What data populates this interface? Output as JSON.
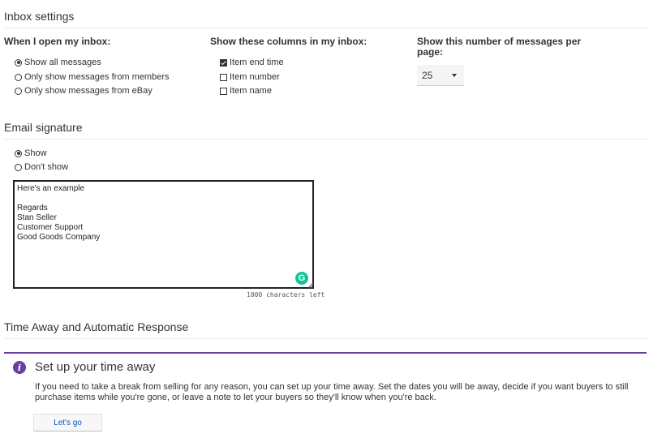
{
  "inbox": {
    "section_title": "Inbox settings",
    "open_inbox": {
      "heading": "When I open my inbox:",
      "options": [
        {
          "label": "Show all messages",
          "checked": true
        },
        {
          "label": "Only show messages from members",
          "checked": false
        },
        {
          "label": "Only show messages from eBay",
          "checked": false
        }
      ]
    },
    "columns": {
      "heading": "Show these columns in my inbox:",
      "options": [
        {
          "label": "Item end time",
          "checked": true
        },
        {
          "label": "Item number",
          "checked": false
        },
        {
          "label": "Item name",
          "checked": false
        }
      ]
    },
    "per_page": {
      "heading_line1": "Show this number of messages per",
      "heading_line2": "page:",
      "value": "25"
    }
  },
  "signature": {
    "section_title": "Email signature",
    "options": [
      {
        "label": "Show",
        "checked": true
      },
      {
        "label": "Don't show",
        "checked": false
      }
    ],
    "text": "Here's an example\n\nRegards\nStan Seller\nCustomer Support\nGood Goods Company",
    "counter": "1000 characters left",
    "grammarly_letter": "G"
  },
  "time_away": {
    "section_title": "Time Away and Automatic Response",
    "notice_title": "Set up your time away",
    "notice_body": "If you need to take a break from selling for any reason, you can set up your time away. Set the dates you will be away, decide if you want buyers to still purchase items while you're gone, or leave a note to let your buyers so they'll know when you're back.",
    "button_label": "Let's go",
    "info_glyph": "i"
  },
  "colors": {
    "accent_purple": "#6b3fa0",
    "link_blue": "#0654ba",
    "grammarly_green": "#15c39a"
  }
}
